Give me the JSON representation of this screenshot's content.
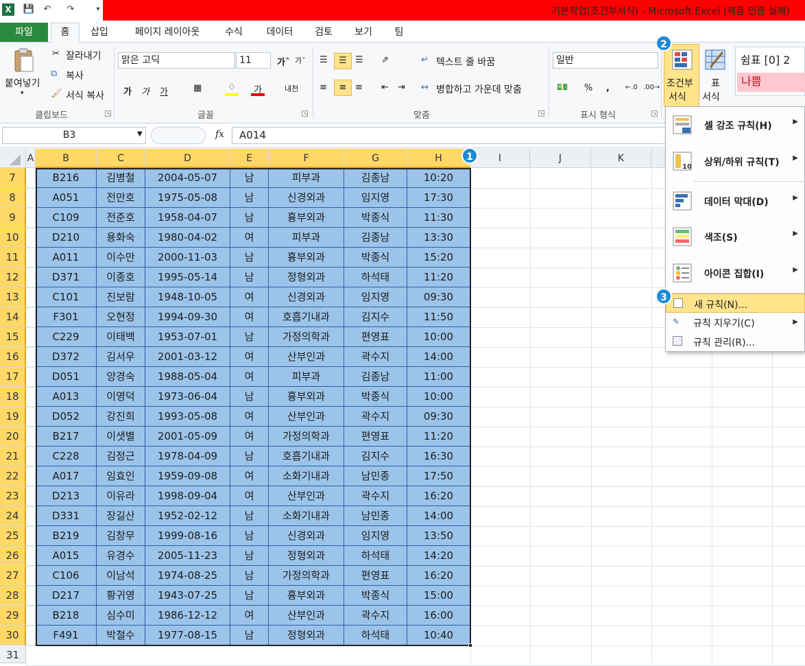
{
  "app": {
    "title": "기본작업(조건부서식) - Microsoft Excel (제품 인증 실패)"
  },
  "tabs": {
    "file": "파일",
    "home": "홈",
    "insert": "삽입",
    "layout": "페이지 레이아웃",
    "formulas": "수식",
    "data": "데이터",
    "review": "검토",
    "view": "보기",
    "team": "팀"
  },
  "ribbon": {
    "paste": "붙여넣기",
    "cut": "잘라내기",
    "copy": "복사",
    "format_painter": "서식 복사",
    "clipboard_label": "클립보드",
    "font_name": "맑은 고딕",
    "font_size": "11",
    "font_label": "글꼴",
    "wrap_text": "텍스트 줄 바꿈",
    "merge_center": "병합하고 가운데 맞춤",
    "align_label": "맞춤",
    "number_format": "일반",
    "percent": "%",
    "comma": ",",
    "number_label": "표시 형식",
    "cond_format_line1": "조건부",
    "cond_format_line2": "서식",
    "table_format_line1": "표",
    "table_format_line2": "서식",
    "style_comma": "쉼표 [0] 2",
    "style_bad": "나쁨",
    "bold": "가",
    "italic": "가",
    "underline": "가"
  },
  "namebox": "B3",
  "formula": "A014",
  "fx": "fx",
  "columns": [
    "A",
    "B",
    "C",
    "D",
    "E",
    "F",
    "G",
    "H",
    "I",
    "J",
    "K"
  ],
  "rows": [
    {
      "n": "7",
      "c": [
        "B216",
        "김병철",
        "2004-05-07",
        "남",
        "피부과",
        "김종남",
        "10:20"
      ]
    },
    {
      "n": "8",
      "c": [
        "A051",
        "전만호",
        "1975-05-08",
        "남",
        "신경외과",
        "임지영",
        "17:30"
      ]
    },
    {
      "n": "9",
      "c": [
        "C109",
        "전준호",
        "1958-04-07",
        "남",
        "흉부외과",
        "박종식",
        "11:30"
      ]
    },
    {
      "n": "10",
      "c": [
        "D210",
        "용화숙",
        "1980-04-02",
        "여",
        "피부과",
        "김종남",
        "13:30"
      ]
    },
    {
      "n": "11",
      "c": [
        "A011",
        "이수만",
        "2000-11-03",
        "남",
        "흉부외과",
        "박종식",
        "15:20"
      ]
    },
    {
      "n": "12",
      "c": [
        "D371",
        "이종호",
        "1995-05-14",
        "남",
        "정형외과",
        "하석태",
        "11:20"
      ]
    },
    {
      "n": "13",
      "c": [
        "C101",
        "진보람",
        "1948-10-05",
        "여",
        "신경외과",
        "임지영",
        "09:30"
      ]
    },
    {
      "n": "14",
      "c": [
        "F301",
        "오현정",
        "1994-09-30",
        "여",
        "호흡기내과",
        "김지수",
        "11:50"
      ]
    },
    {
      "n": "15",
      "c": [
        "C229",
        "이태백",
        "1953-07-01",
        "남",
        "가정의학과",
        "편영표",
        "10:00"
      ]
    },
    {
      "n": "16",
      "c": [
        "D372",
        "김서우",
        "2001-03-12",
        "여",
        "산부인과",
        "곽수지",
        "14:00"
      ]
    },
    {
      "n": "17",
      "c": [
        "D051",
        "양경숙",
        "1988-05-04",
        "여",
        "피부과",
        "김종남",
        "11:00"
      ]
    },
    {
      "n": "18",
      "c": [
        "A013",
        "이영덕",
        "1973-06-04",
        "남",
        "흉부외과",
        "박종식",
        "10:00"
      ]
    },
    {
      "n": "19",
      "c": [
        "D052",
        "강진희",
        "1993-05-08",
        "여",
        "산부인과",
        "곽수지",
        "09:30"
      ]
    },
    {
      "n": "20",
      "c": [
        "B217",
        "이샛별",
        "2001-05-09",
        "여",
        "가정의학과",
        "편영표",
        "11:20"
      ]
    },
    {
      "n": "21",
      "c": [
        "C228",
        "김정근",
        "1978-04-09",
        "남",
        "호흡기내과",
        "김지수",
        "16:30"
      ]
    },
    {
      "n": "22",
      "c": [
        "A017",
        "임효인",
        "1959-09-08",
        "여",
        "소화기내과",
        "남민종",
        "17:50"
      ]
    },
    {
      "n": "23",
      "c": [
        "D213",
        "이유라",
        "1998-09-04",
        "여",
        "산부인과",
        "곽수지",
        "16:20"
      ]
    },
    {
      "n": "24",
      "c": [
        "D331",
        "장길산",
        "1952-02-12",
        "남",
        "소화기내과",
        "남민종",
        "14:00"
      ]
    },
    {
      "n": "25",
      "c": [
        "B219",
        "김창무",
        "1999-08-16",
        "남",
        "신경외과",
        "임지영",
        "13:50"
      ]
    },
    {
      "n": "26",
      "c": [
        "A015",
        "유경수",
        "2005-11-23",
        "남",
        "정형외과",
        "하석태",
        "14:20"
      ]
    },
    {
      "n": "27",
      "c": [
        "C106",
        "이남석",
        "1974-08-25",
        "남",
        "가정의학과",
        "편영표",
        "16:20"
      ]
    },
    {
      "n": "28",
      "c": [
        "D217",
        "황귀영",
        "1943-07-25",
        "남",
        "흉부외과",
        "박종식",
        "15:00"
      ]
    },
    {
      "n": "29",
      "c": [
        "B218",
        "심수미",
        "1986-12-12",
        "여",
        "산부인과",
        "곽수지",
        "16:00"
      ]
    },
    {
      "n": "30",
      "c": [
        "F491",
        "박철수",
        "1977-08-15",
        "남",
        "정형외과",
        "하석태",
        "10:40"
      ]
    }
  ],
  "last_row": "31",
  "menu": {
    "highlight_rules": "셀 강조 규칙(H)",
    "top_bottom": "상위/하위 규칙(T)",
    "data_bars": "데이터 막대(D)",
    "color_scales": "색조(S)",
    "icon_sets": "아이콘 집합(I)",
    "new_rule": "새 규칙(N)...",
    "clear_rules": "규칙 지우기(C)",
    "manage_rules": "규칙 관리(R)..."
  },
  "badges": [
    "1",
    "2",
    "3"
  ],
  "colors": {
    "title_bar": "#ff0000",
    "selection": "#9cc4ea",
    "header_selected": "#ffd866",
    "menu_highlight": "#ffe48c",
    "badge": "#1e8bd6"
  }
}
